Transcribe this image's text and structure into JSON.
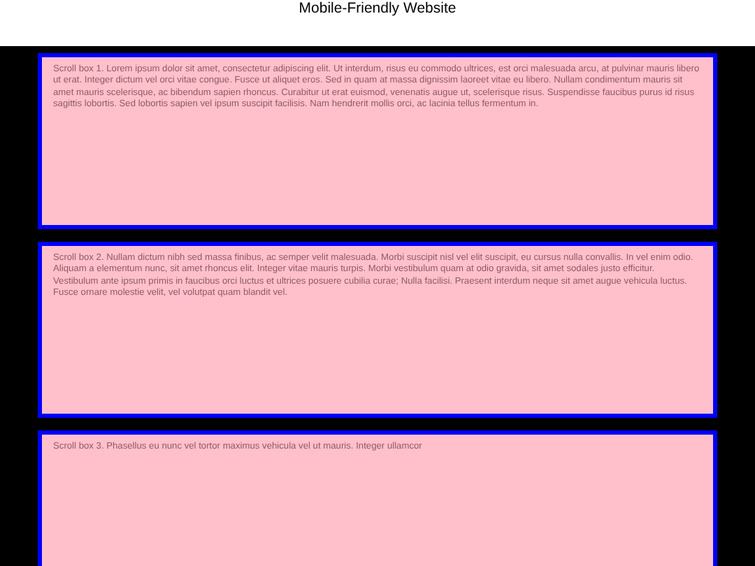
{
  "header": {
    "title": "Mobile-Friendly Website"
  },
  "scroll_boxes": [
    {
      "text": "Scroll box 1. Lorem ipsum dolor sit amet, consectetur adipiscing elit. Ut interdum, risus eu commodo ultrices, est orci malesuada arcu, at pulvinar mauris libero ut erat. Integer dictum vel orci vitae congue. Fusce ut aliquet eros. Sed in quam at massa dignissim laoreet vitae eu libero. Nullam condimentum mauris sit amet mauris scelerisque, ac bibendum sapien rhoncus. Curabitur ut erat euismod, venenatis augue ut, scelerisque risus. Suspendisse faucibus purus id risus sagittis lobortis. Sed lobortis sapien vel ipsum suscipit facilisis. Nam hendrerit mollis orci, ac lacinia tellus fermentum in."
    },
    {
      "text": "Scroll box 2. Nullam dictum nibh sed massa finibus, ac semper velit malesuada. Morbi suscipit nisl vel elit suscipit, eu cursus nulla convallis. In vel enim odio. Aliquam a elementum nunc, sit amet rhoncus elit. Integer vitae mauris turpis. Morbi vestibulum quam at odio gravida, sit amet sodales justo efficitur. Vestibulum ante ipsum primis in faucibus orci luctus et ultrices posuere cubilia curae; Nulla facilisi. Praesent interdum neque sit amet augue vehicula luctus. Fusce ornare molestie velit, vel volutpat quam blandit vel."
    },
    {
      "text": "Scroll box 3. Phasellus eu nunc vel tortor maximus vehicula vel ut mauris. Integer ullamcor"
    }
  ]
}
